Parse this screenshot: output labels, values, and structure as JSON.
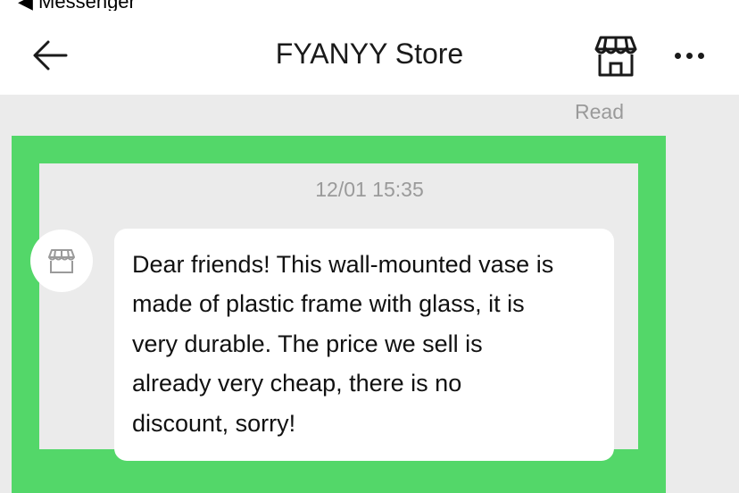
{
  "status_bar": {
    "back_app_label": "◀ Messenger"
  },
  "header": {
    "back_icon": "arrow-left-icon",
    "title": "FYANYY Store",
    "store_icon": "storefront-icon",
    "more_icon": "more-horizontal-icon"
  },
  "chat": {
    "read_status": "Read",
    "timestamp": "12/01 15:35",
    "message": {
      "sender_avatar_icon": "storefront-icon",
      "text": "Dear friends! This wall-mounted vase is\nmade of plastic frame with glass, it is\nvery durable. The price we sell is\nalready very cheap, there is no\ndiscount, sorry!"
    }
  },
  "colors": {
    "highlight": "#53d769",
    "chat_background": "#ebebeb",
    "bubble": "#ffffff",
    "muted_text": "#9a9a9a"
  }
}
